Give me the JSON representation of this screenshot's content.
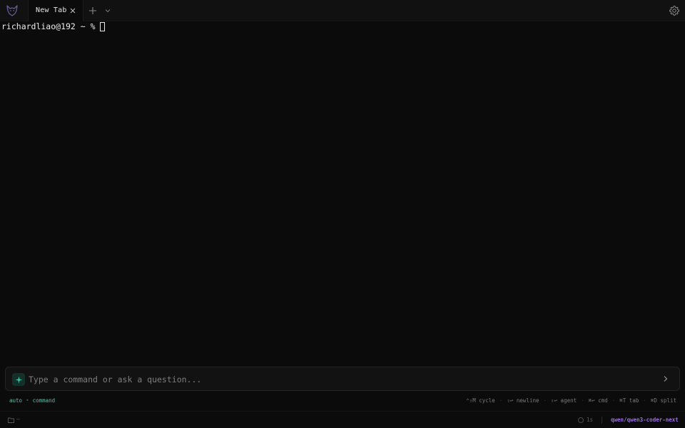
{
  "app": {
    "logo_icon": "wolf-logo-icon",
    "accent_color": "#4fc3a8",
    "model_color": "#9b6fe0"
  },
  "tabs": [
    {
      "label": "New Tab",
      "active": true
    }
  ],
  "tabbar": {
    "new_tab_icon": "plus-icon",
    "dropdown_icon": "chevron-down-icon",
    "settings_icon": "gear-icon"
  },
  "terminal": {
    "prompt": "richardliao@192 ~ %"
  },
  "input": {
    "placeholder": "Type a command or ask a question...",
    "value": "",
    "ai_icon": "sparkle-icon",
    "submit_icon": "chevron-right-icon"
  },
  "hints": {
    "mode": "auto",
    "mode_separator": "•",
    "submode": "command",
    "shortcuts": [
      "⌃⇧M cycle",
      "⇧↩ newline",
      "⇧↩ agent",
      "⌘↩ cmd",
      "⌘T tab",
      "⌘D split"
    ],
    "shortcut_separator": "·"
  },
  "statusbar": {
    "folder_icon": "folder-icon",
    "folder_label": "–",
    "timer_icon": "spinner-ring-icon",
    "timer": "1s",
    "model": "qwen/qwen3-coder-next"
  }
}
